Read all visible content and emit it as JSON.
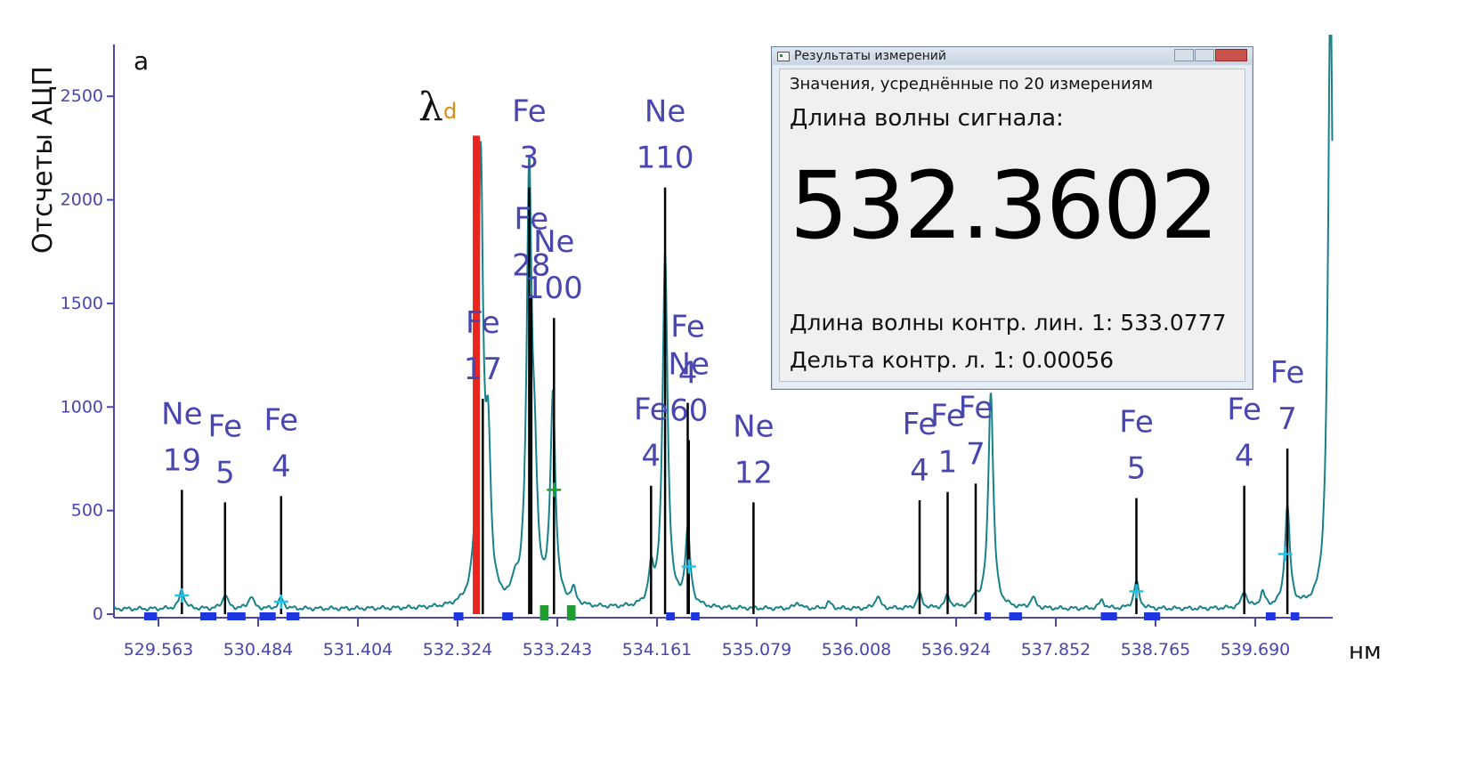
{
  "panel_letter": "a",
  "lambda_symbol": "λ",
  "lambda_subscript": "d",
  "dialog": {
    "title": "Результаты измерений",
    "subtitle": "Значения, усреднённые по 20 измерениям",
    "heading": "Длина волны сигнала:",
    "value": "532.3602",
    "line1": "Длина волны контр. лин. 1: 533.0777",
    "line2": "Дельта контр. л. 1: 0.00056"
  },
  "chart_data": {
    "type": "line",
    "title": "",
    "xlabel": "нм",
    "ylabel": "Отсчеты АЦП",
    "xlim": [
      529.0,
      540.3
    ],
    "ylim": [
      0,
      2750
    ],
    "x_ticks": [
      "529.563",
      "530.484",
      "531.404",
      "532.324",
      "533.243",
      "534.161",
      "535.079",
      "536.008",
      "536.924",
      "537.852",
      "538.765",
      "539.690"
    ],
    "y_ticks": [
      "0",
      "500",
      "1000",
      "1500",
      "2000",
      "2500"
    ],
    "reference_lines": [
      {
        "element": "Ne",
        "intensity": "19",
        "x": 529.63,
        "height": 600
      },
      {
        "element": "Fe",
        "intensity": "5",
        "x": 530.03,
        "height": 540
      },
      {
        "element": "Fe",
        "intensity": "4",
        "x": 530.55,
        "height": 570
      },
      {
        "element": "Fe",
        "intensity": "17",
        "x": 532.42,
        "height": 1040
      },
      {
        "element": "Fe",
        "intensity": "3",
        "x": 532.85,
        "height": 2060
      },
      {
        "element": "Fe",
        "intensity": "28",
        "x": 532.87,
        "height": 1540
      },
      {
        "element": "Ne",
        "intensity": "100",
        "x": 533.08,
        "height": 1430
      },
      {
        "element": "Fe",
        "intensity": "4",
        "x": 533.98,
        "height": 620
      },
      {
        "element": "Ne",
        "intensity": "110",
        "x": 534.11,
        "height": 2060
      },
      {
        "element": "Ne",
        "intensity": "60",
        "x": 534.33,
        "height": 840
      },
      {
        "element": "Fe",
        "intensity": "4",
        "x": 534.32,
        "height": 1020
      },
      {
        "element": "Ne",
        "intensity": "12",
        "x": 534.93,
        "height": 540
      },
      {
        "element": "Fe",
        "intensity": "4",
        "x": 536.47,
        "height": 550
      },
      {
        "element": "Fe",
        "intensity": "1",
        "x": 536.73,
        "height": 590
      },
      {
        "element": "Fe",
        "intensity": "7",
        "x": 536.99,
        "height": 630
      },
      {
        "element": "Fe",
        "intensity": "5",
        "x": 538.48,
        "height": 560
      },
      {
        "element": "Fe",
        "intensity": "4",
        "x": 539.48,
        "height": 620
      },
      {
        "element": "Fe",
        "intensity": "7",
        "x": 539.88,
        "height": 800
      }
    ],
    "signal_line": {
      "x": 532.36,
      "height": 2310
    },
    "spectrum_peaks": [
      {
        "x": 529.63,
        "height": 90
      },
      {
        "x": 530.03,
        "height": 70
      },
      {
        "x": 530.27,
        "height": 60
      },
      {
        "x": 530.55,
        "height": 50
      },
      {
        "x": 532.4,
        "height": 2150
      },
      {
        "x": 532.47,
        "height": 700
      },
      {
        "x": 532.72,
        "height": 80
      },
      {
        "x": 532.85,
        "height": 2050
      },
      {
        "x": 532.9,
        "height": 500
      },
      {
        "x": 533.07,
        "height": 1000
      },
      {
        "x": 533.26,
        "height": 70
      },
      {
        "x": 533.98,
        "height": 160
      },
      {
        "x": 534.11,
        "height": 1700
      },
      {
        "x": 534.32,
        "height": 360
      },
      {
        "x": 535.34,
        "height": 30
      },
      {
        "x": 535.63,
        "height": 30
      },
      {
        "x": 536.08,
        "height": 60
      },
      {
        "x": 536.47,
        "height": 70
      },
      {
        "x": 536.73,
        "height": 60
      },
      {
        "x": 536.99,
        "height": 50
      },
      {
        "x": 537.13,
        "height": 1050
      },
      {
        "x": 537.52,
        "height": 50
      },
      {
        "x": 538.16,
        "height": 40
      },
      {
        "x": 538.48,
        "height": 130
      },
      {
        "x": 539.48,
        "height": 80
      },
      {
        "x": 539.65,
        "height": 70
      },
      {
        "x": 539.88,
        "height": 480
      },
      {
        "x": 540.28,
        "height": 3000
      }
    ],
    "colors": {
      "spectrum": "#17828a",
      "reference": "#000000",
      "signal": "#e8251f",
      "tick": "#4a46b0",
      "axis": "#4a46b0",
      "cyan_marker": "#1fc4e8",
      "green_marker": "#1e9e2e",
      "blue_band": "#1f35e0"
    }
  }
}
